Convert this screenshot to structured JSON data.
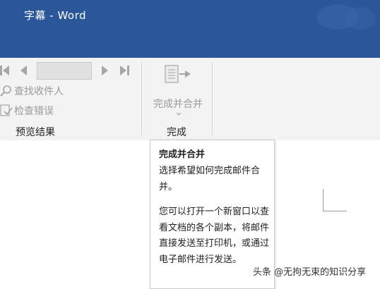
{
  "window": {
    "title": "字幕  -  Word"
  },
  "ribbon": {
    "preview_group": {
      "label": "预览结果",
      "find_recipient": "查找收件人",
      "check_errors": "检查错误"
    },
    "finish_group": {
      "label": "完成",
      "finish_merge": "完成并合并"
    }
  },
  "tooltip": {
    "title": "完成并合并",
    "paragraph1": "选择希望如何完成邮件合并。",
    "paragraph2": "您可以打开一个新窗口以查看文档的各个副本，将邮件直接发送至打印机，或通过电子邮件进行发送。"
  },
  "watermark_caption": "头条 @无拘无束的知识分享",
  "colors": {
    "titlebar": "#2b579a",
    "ribbon_bg": "#f3f3f3",
    "disabled_text": "#9a9a9a"
  }
}
